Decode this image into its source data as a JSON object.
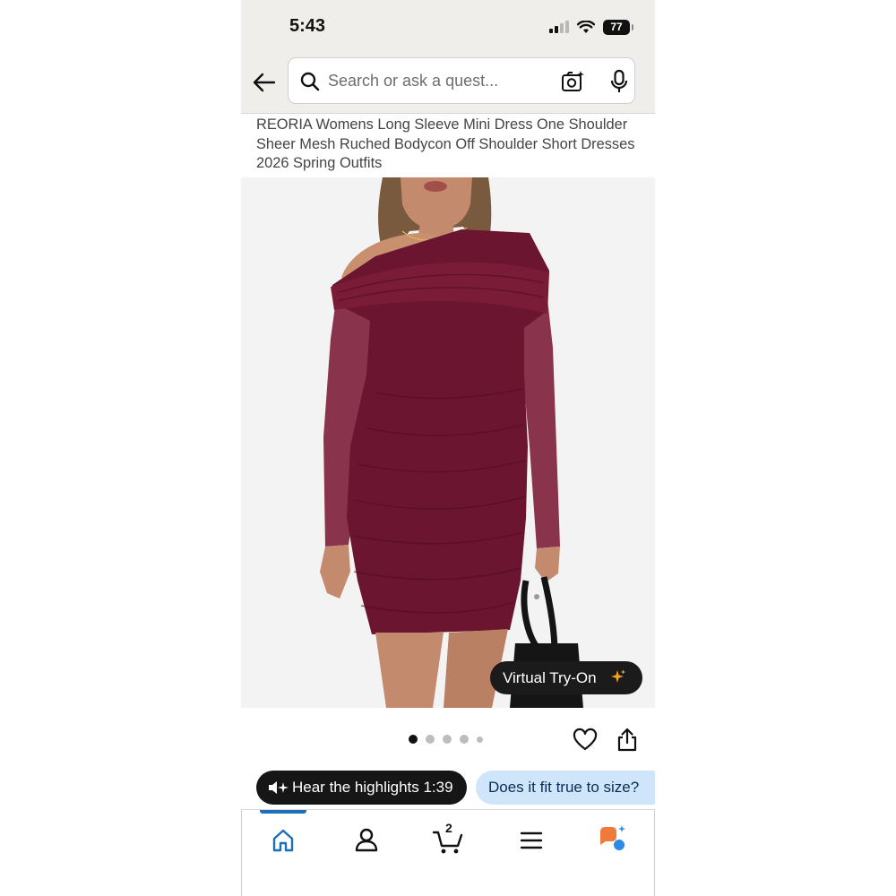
{
  "status_bar": {
    "time": "5:43",
    "battery": "77"
  },
  "search": {
    "placeholder": "Search or ask a quest..."
  },
  "product": {
    "title": "REORIA Womens Long Sleeve Mini Dress One Shoulder Sheer Mesh Ruched Bodycon Off Shoulder Short Dresses 2026 Spring Outfits",
    "dress_color": "#6b1530"
  },
  "image_controls": {
    "virtual_try_on_label": "Virtual Try-On",
    "total_images": 5,
    "current_image": 1
  },
  "chips": {
    "highlights_label": "Hear the highlights 1:39",
    "fit_question": "Does it fit true to size?"
  },
  "bottom_nav": {
    "items": [
      "home-icon",
      "account-icon",
      "cart-icon",
      "menu-icon",
      "rufus-icon"
    ],
    "cart_count": "2"
  },
  "colors": {
    "accent_blue": "#1d6fb8",
    "chip_blue_bg": "#cfe6fa",
    "sparkle_orange": "#f6a21c",
    "rufus_orange": "#f07a3c",
    "rufus_blue": "#2a8ce6"
  }
}
